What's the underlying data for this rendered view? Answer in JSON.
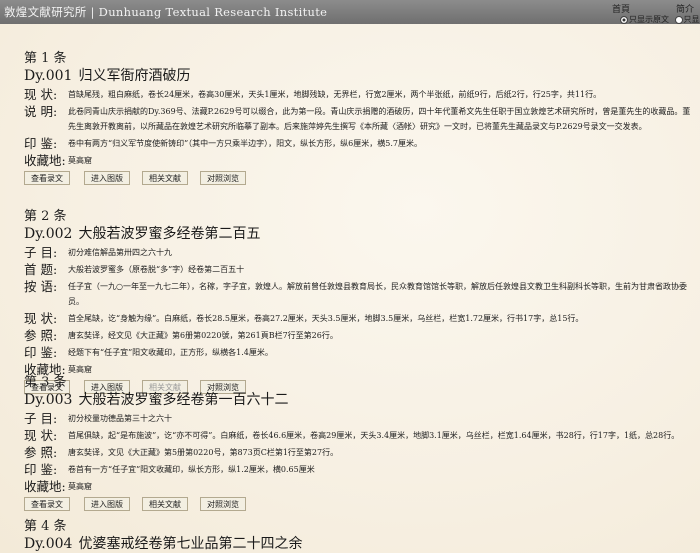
{
  "header": {
    "site_title": "敦煌文献研究所 | Dunhuang Textual Research Institute",
    "nav_home": "首頁",
    "nav_intro": "简介",
    "radio_text_only": "只显示原文",
    "radio_all": "只显示"
  },
  "buttons": {
    "view_record": "查看录文",
    "view_image": "进入图版",
    "related": "相关文献",
    "compare": "对照浏览"
  },
  "entries": [
    {
      "seq": "第 1 条",
      "id": "Dy.001",
      "title": "归义军衙府酒破历",
      "rows": [
        {
          "label": "现  状:",
          "value": "首缺尾残，粗白麻纸，卷长24厘米，卷高30厘米，天头1厘米，地脚残缺，无界栏，行宽2厘米，两个半张纸，前纸9行，后纸2行，行25字，共11行。"
        },
        {
          "label": "说  明:",
          "value": "此卷同青山庆示捐献的Dy.369号、法藏P.2629号可以缀合，此为第一段。青山庆示捐赠的酒破历，四十年代董希文先生任职于国立敦煌艺术研究所时，曾是董先生的收藏品。董先生离敦开教离前，以所藏品在敦煌艺术研究所临摹了副本。后来施萍婷先生撰写《本所藏〈酒帐〉研究》一文时，已将董先生藏品录文与P.2629号录文一交发表。"
        },
        {
          "label": "印  鉴:",
          "value": "卷中有两方“归义军节度使新铸印”（其中一方只乘半边字），阳文，纵长方形，纵6厘米，横5.7厘米。"
        },
        {
          "label": "收藏地:",
          "value": "莫高窟"
        }
      ],
      "related_disabled": false
    },
    {
      "seq": "第 2 条",
      "id": "Dy.002",
      "title": "大般若波罗蜜多经卷第二百五",
      "rows": [
        {
          "label": "子  目:",
          "value": "初分难信解品第卅四之六十九"
        },
        {
          "label": "首  题:",
          "value": "大般若波罗蜜多（原卷脱“多”字）经卷第二百五十"
        },
        {
          "label": "按  语:",
          "value": "任子宜（一九○一年至一九七二年），名稼，字子宜，敦煌人。解放前曾任敦煌县教育局长，民众教育馆馆长等职，解放后任敦煌县文教卫生科副科长等职，生前为甘肃省政协委员。"
        },
        {
          "label": "现  状:",
          "value": "首全尾缺，讫“身触为缘”。白麻纸，卷长28.5厘米，卷高27.2厘米，天头3.5厘米，地脚3.5厘米，乌丝栏，栏宽1.72厘米，行书17字，总15行。"
        },
        {
          "label": "参  照:",
          "value": "唐玄奘译，经文见《大正藏》第6册第0220號，第261頁B栏7行至第26行。"
        },
        {
          "label": "印  鉴:",
          "value": "经题下有“任子宜”阳文收藏印，正方形，纵横各1.4厘米。"
        },
        {
          "label": "收藏地:",
          "value": "莫高窟"
        }
      ],
      "related_disabled": true
    },
    {
      "seq": "第 3 条",
      "id": "Dy.003",
      "title": "大般若波罗蜜多经卷第一百六十二",
      "rows": [
        {
          "label": "子  目:",
          "value": "初分校量功德品第三十之六十"
        },
        {
          "label": "现  状:",
          "value": "首尾俱缺，起“是布施波”，讫“亦不可得”。白麻纸，卷长46.6厘米，卷高29厘米，天头3.4厘米，地脚3.1厘米，乌丝栏，栏宽1.64厘米，书28行，行17字，1纸，总28行。"
        },
        {
          "label": "参  照:",
          "value": "唐玄奘译，文见《大正藏》第5册第0220号，第873页C栏第1行至第27行。"
        },
        {
          "label": "印  鉴:",
          "value": "卷首有一方“任子宜”阳文收藏印，纵长方形，纵1.2厘米，横0.65厘米"
        },
        {
          "label": "收藏地:",
          "value": "莫高窟"
        }
      ],
      "related_disabled": false
    },
    {
      "seq": "第 4 条",
      "id": "Dy.004",
      "title": "优婆塞戒经卷第七业品第二十四之余",
      "rows": [],
      "related_disabled": false
    }
  ]
}
